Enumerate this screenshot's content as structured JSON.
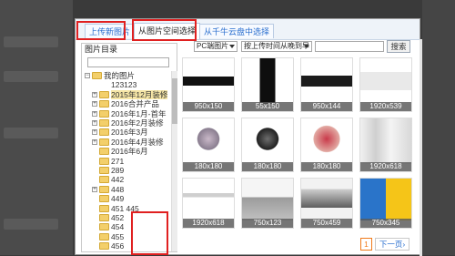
{
  "tabs": [
    {
      "label": "上传新图片"
    },
    {
      "label": "从图片空间选择"
    },
    {
      "label": "从千牛云盘中选择"
    }
  ],
  "sidebar": {
    "title": "图片目录",
    "tree": [
      {
        "label": "我的图片",
        "expander": "−",
        "folder": true
      },
      {
        "label": "123123",
        "expander": "",
        "folder": false
      },
      {
        "label": "2015年12月装修",
        "expander": "+",
        "folder": true,
        "selected": true
      },
      {
        "label": "2016合并产品",
        "expander": "+",
        "folder": true
      },
      {
        "label": "2016年1月-首年",
        "expander": "+",
        "folder": true
      },
      {
        "label": "2016年2月装修",
        "expander": "+",
        "folder": true
      },
      {
        "label": "2016年3月",
        "expander": "+",
        "folder": true
      },
      {
        "label": "2016年4月装修",
        "expander": "+",
        "folder": true
      },
      {
        "label": "2016年6月",
        "expander": "",
        "folder": true
      },
      {
        "label": "271",
        "expander": "",
        "folder": true
      },
      {
        "label": "289",
        "expander": "",
        "folder": true
      },
      {
        "label": "442",
        "expander": "",
        "folder": true
      },
      {
        "label": "448",
        "expander": "+",
        "folder": true
      },
      {
        "label": "449",
        "expander": "",
        "folder": true
      },
      {
        "label": "451 445",
        "expander": "",
        "folder": true
      },
      {
        "label": "452",
        "expander": "",
        "folder": true
      },
      {
        "label": "454",
        "expander": "",
        "folder": true
      },
      {
        "label": "455",
        "expander": "",
        "folder": true
      },
      {
        "label": "456",
        "expander": "",
        "folder": true
      }
    ]
  },
  "toolbar": {
    "filter_select": "PC端图片",
    "sort_select": "按上传时间从晚到早",
    "search_value": "",
    "search_button": "搜索"
  },
  "images": [
    {
      "caption": "950x150"
    },
    {
      "caption": "55x150"
    },
    {
      "caption": "950x144"
    },
    {
      "caption": "1920x539"
    },
    {
      "caption": "180x180"
    },
    {
      "caption": "180x180"
    },
    {
      "caption": "180x180"
    },
    {
      "caption": "1920x618"
    },
    {
      "caption": "1920x618"
    },
    {
      "caption": "750x123"
    },
    {
      "caption": "750x459"
    },
    {
      "caption": "750x345"
    }
  ],
  "pagination": {
    "current_page": "1",
    "next_label": "下一页"
  },
  "colors": {
    "highlight_box": "#e02020",
    "tab_link": "#2a6fcf",
    "page_current": "#f07a1a"
  }
}
